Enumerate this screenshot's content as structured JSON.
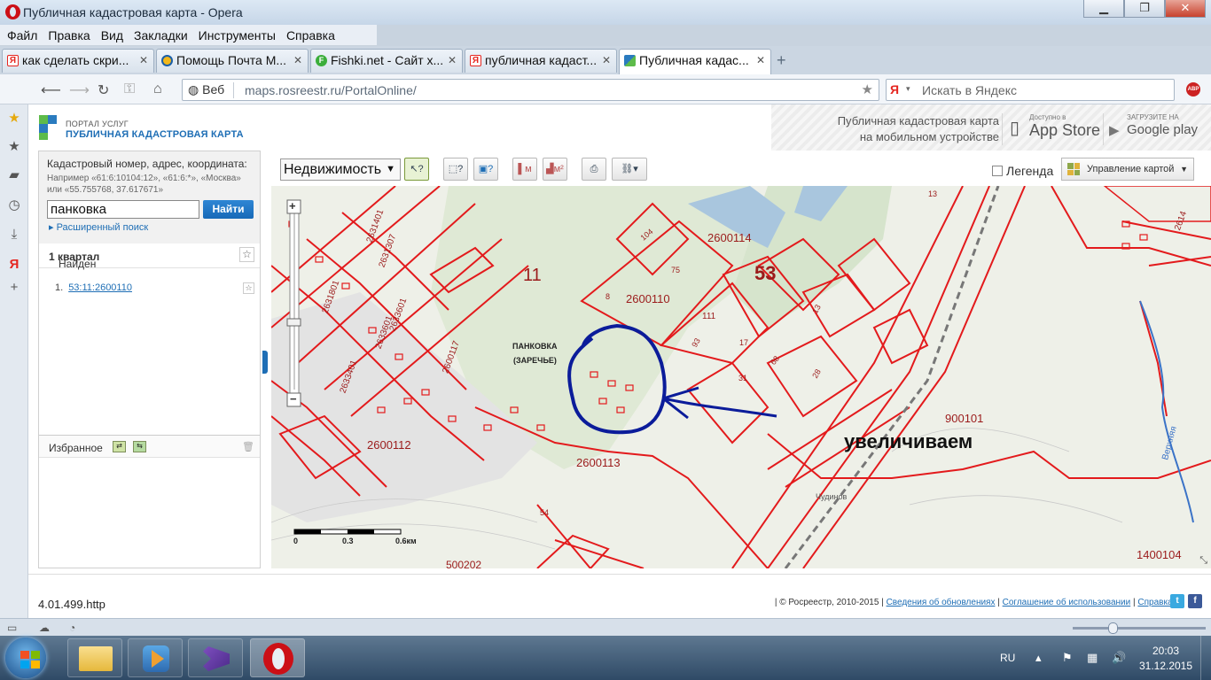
{
  "window": {
    "title": "Публичная кадастровая карта - Opera",
    "minimize": "▁",
    "maximize": "❐",
    "close": "✕"
  },
  "menu": [
    "Файл",
    "Правка",
    "Вид",
    "Закладки",
    "Инструменты",
    "Справка"
  ],
  "tabs": [
    {
      "label": "как сделать скри...",
      "icon": "yandex-icon",
      "color": "#e52620",
      "active": false
    },
    {
      "label": "Помощь Почта M...",
      "icon": "mail-icon",
      "color": "#1a5ea8",
      "active": false
    },
    {
      "label": "Fishki.net - Сайт х...",
      "icon": "fishki-icon",
      "color": "#3bae3b",
      "active": false
    },
    {
      "label": "публичная кадаст...",
      "icon": "yandex-icon",
      "color": "#e52620",
      "active": false
    },
    {
      "label": "Публичная кадас...",
      "icon": "rosreestr-icon",
      "color": "#2a7bbf",
      "active": true
    }
  ],
  "address": {
    "web_label": "Веб",
    "url": "maps.rosreestr.ru/PortalOnline/"
  },
  "yandex_search": {
    "logo": "Я",
    "placeholder": "Искать в Яндекс"
  },
  "adblock": "ABP",
  "portal": {
    "small": "ПОРТАЛ УСЛУГ",
    "big": "ПУБЛИЧНАЯ КАДАСТРОВАЯ КАРТА",
    "mobile_line1": "Публичная кадастровая карта",
    "mobile_line2": "на мобильном устройстве",
    "appstore_small": "Доступно в",
    "appstore_big": "App Store",
    "gplay_small": "ЗАГРУЗИТЕ НА",
    "gplay_big": "Google play"
  },
  "search_panel": {
    "label": "Кадастровый номер, адрес, координата:",
    "hint": "Например «61:6:10104:12», «61:6:*», «Москва» или «55.755768, 37.617671»",
    "value": "панковка",
    "button": "Найти",
    "advanced": "Расширенный поиск",
    "found_prefix": "Найден",
    "found_count": "1 квартал",
    "result_num": "1.",
    "result": "53:11:2600110",
    "favorites": "Избранное"
  },
  "toolbar": {
    "layer": "Недвижимость",
    "legend": "Легенда",
    "map_control": "Управление картой"
  },
  "map": {
    "labels": {
      "q11": "11",
      "q53": "53",
      "l2600114": "2600114",
      "l2600110": "2600110",
      "l2600113": "2600113",
      "l2600112": "2600112",
      "l900101": "900101",
      "l1400104": "1400104",
      "l500202": "500202",
      "l104": "104",
      "l75": "75",
      "l8": "8",
      "l111": "111",
      "l93": "93",
      "l17": "17",
      "l68": "68",
      "l31": "31",
      "l28": "28",
      "l13": "13",
      "l54": "54",
      "l13b": "13",
      "l2614": "2614",
      "v1": "2633601",
      "v2": "2633401",
      "v3": "2631801",
      "v4": "2631307",
      "v5": "2631401",
      "v6": "2600117",
      "v7": "2633601",
      "place1": "ПАНКОВКА",
      "place2": "(ЗАРЕЧЬЕ)",
      "river": "Верхняя",
      "lake": "Чудинов",
      "note": "увеличиваем"
    },
    "scale": {
      "s0": "0",
      "s1": "0.3",
      "s2": "0.6км"
    },
    "colors": {
      "parcel": "#e31a1c",
      "annotation": "#0b1c9a"
    }
  },
  "footer": {
    "version": "4.01.499.http",
    "copyright": "© Росреестр, 2010-2015",
    "link1": "Сведения об обновлениях",
    "link2": "Соглашение об использовании",
    "link3": "Справка"
  },
  "taskbar": {
    "lang": "RU",
    "time": "20:03",
    "date": "31.12.2015"
  }
}
